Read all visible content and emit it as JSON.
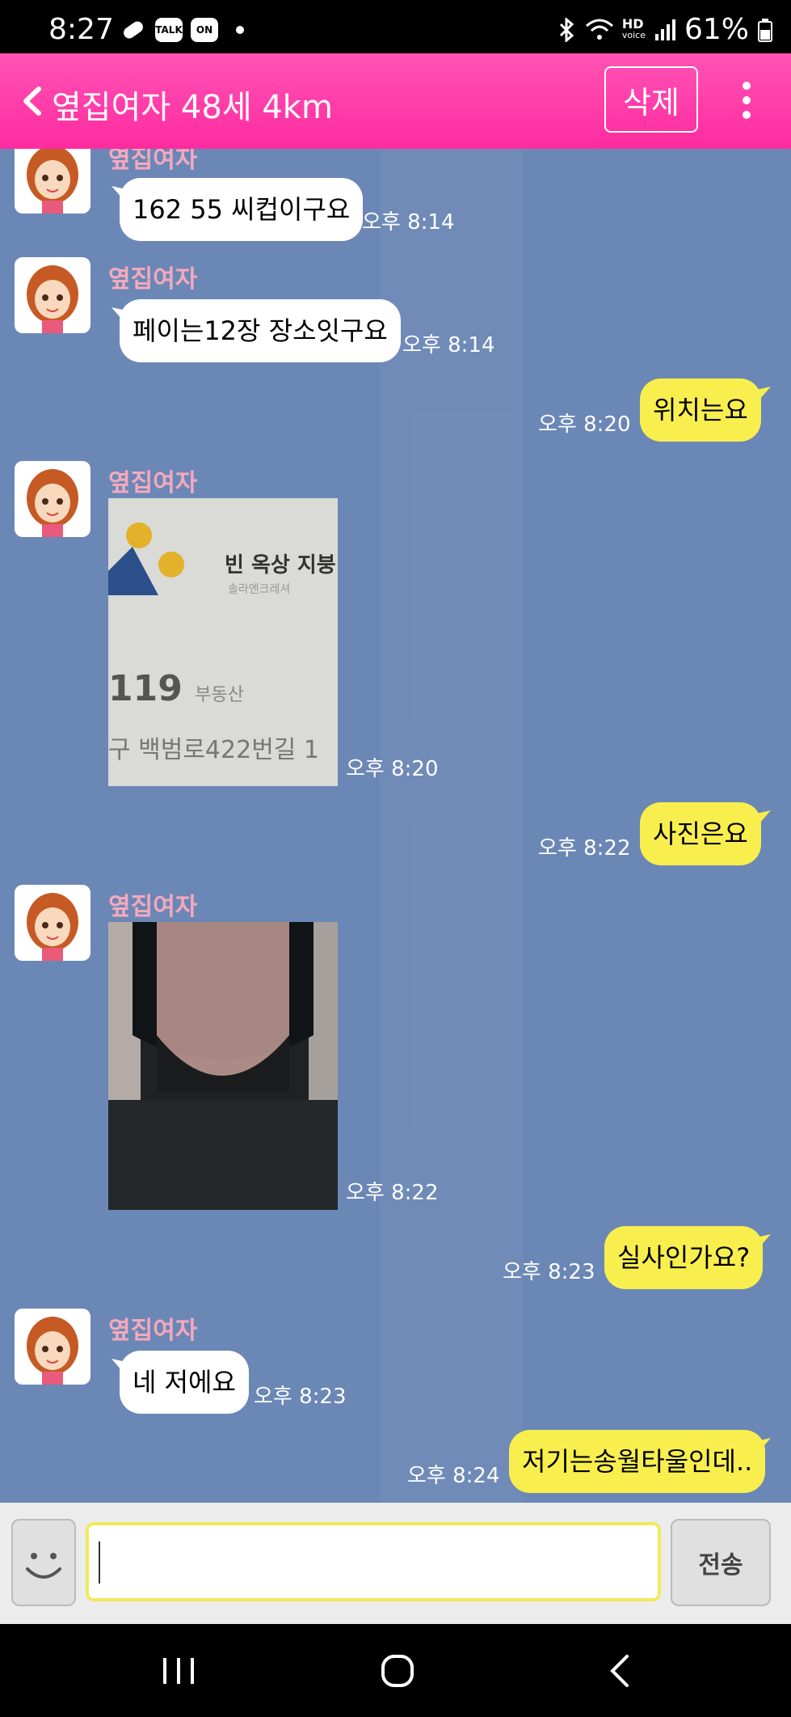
{
  "status_bar": {
    "time": "8:27",
    "left_icons": [
      "link-icon",
      "talk-icon",
      "on-icon"
    ],
    "talk_label": "TALK",
    "on_label": "ON",
    "hd_label": "HD",
    "voice_label": "voice",
    "battery": "61%"
  },
  "header": {
    "title": "옆집여자 48세 4km",
    "delete_label": "삭제"
  },
  "messages": [
    {
      "type": "in",
      "name": "옆집여자",
      "text": "162 55 씨컵이구요",
      "time": "오후 8:14"
    },
    {
      "type": "in",
      "name": "옆집여자",
      "text": "페이는12장 장소잇구요",
      "time": "오후 8:14"
    },
    {
      "type": "out",
      "text": "위치는요",
      "time": "오후 8:20"
    },
    {
      "type": "in-photo",
      "name": "옆집여자",
      "time": "오후 8:20",
      "photo_text": [
        "빈 옥상 지붕",
        "솔라엔크레셔",
        "119",
        "부동산",
        "구 백범로422번길 1"
      ]
    },
    {
      "type": "out",
      "text": "사진은요",
      "time": "오후 8:22"
    },
    {
      "type": "in-photo",
      "name": "옆집여자",
      "time": "오후 8:22"
    },
    {
      "type": "out",
      "text": "실사인가요?",
      "time": "오후 8:23"
    },
    {
      "type": "in",
      "name": "옆집여자",
      "text": "네 저에요",
      "time": "오후 8:23"
    },
    {
      "type": "out",
      "text": "저기는송월타울인데..",
      "time": "오후 8:24"
    }
  ],
  "input_bar": {
    "value": "",
    "send_label": "전송"
  },
  "colors": {
    "header": "#ff3fa8",
    "chat_bg": "#6b87b6",
    "bubble_out": "#f8ef4f",
    "bubble_in": "#ffffff",
    "name": "#f4a9bd"
  }
}
